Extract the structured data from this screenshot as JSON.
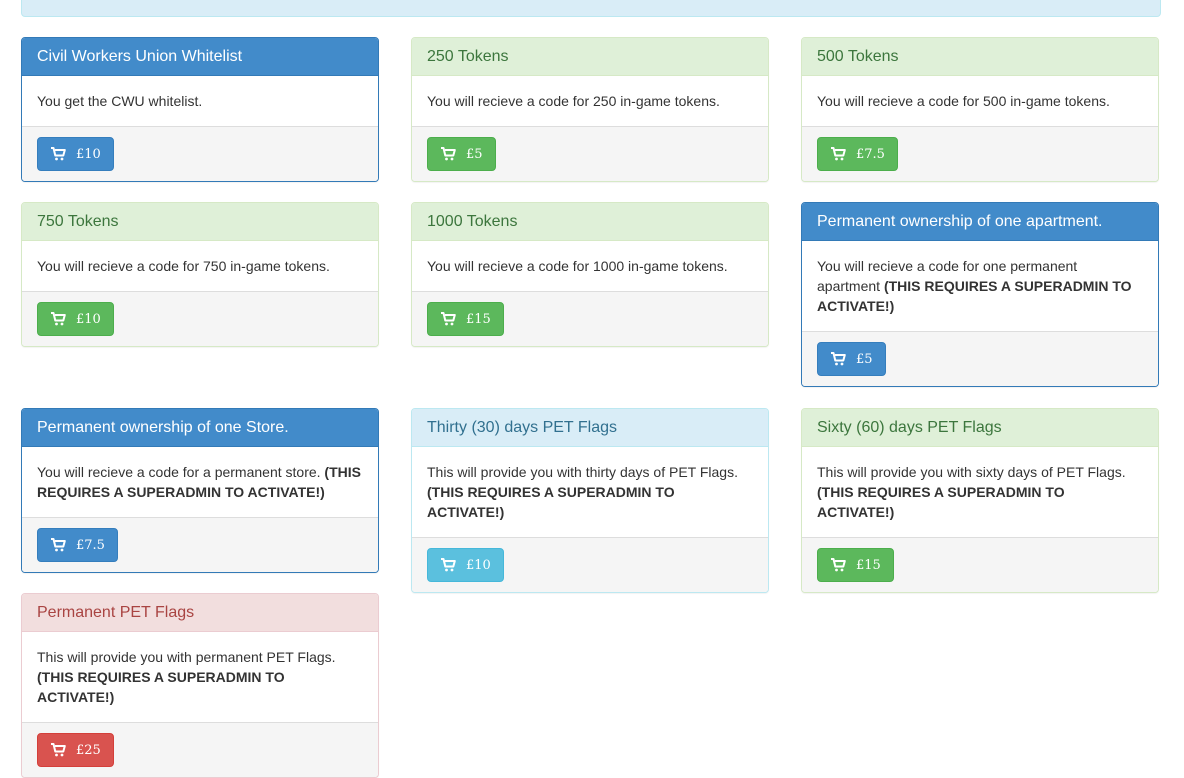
{
  "colors": {
    "primary": "#428bca",
    "success": "#5cb85c",
    "info": "#5bc0de",
    "danger": "#d9534f"
  },
  "products": [
    {
      "title": "Civil Workers Union Whitelist",
      "desc": "You get the CWU whitelist.",
      "note": "",
      "price": "£10"
    },
    {
      "title": "250 Tokens",
      "desc": "You will recieve a code for 250 in-game tokens.",
      "note": "",
      "price": "£5"
    },
    {
      "title": "500 Tokens",
      "desc": "You will recieve a code for 500 in-game tokens.",
      "note": "",
      "price": "£7.5"
    },
    {
      "title": "750 Tokens",
      "desc": "You will recieve a code for 750 in-game tokens.",
      "note": "",
      "price": "£10"
    },
    {
      "title": "1000 Tokens",
      "desc": "You will recieve a code for 1000 in-game tokens.",
      "note": "",
      "price": "£15"
    },
    {
      "title": "Permanent ownership of one apartment.",
      "desc": "You will recieve a code for one permanent apartment ",
      "note": "(THIS REQUIRES A SUPERADMIN TO ACTIVATE!)",
      "price": "£5"
    },
    {
      "title": "Permanent ownership of one Store.",
      "desc": "You will recieve a code for a permanent store. ",
      "note": "(THIS REQUIRES A SUPERADMIN TO ACTIVATE!)",
      "price": "£7.5"
    },
    {
      "title": "Thirty (30) days PET Flags",
      "desc": "This will provide you with thirty days of PET Flags. ",
      "note": "(THIS REQUIRES A SUPERADMIN TO ACTIVATE!)",
      "price": "£10"
    },
    {
      "title": "Sixty (60) days PET Flags",
      "desc": "This will provide you with sixty days of PET Flags. ",
      "note": "(THIS REQUIRES A SUPERADMIN TO ACTIVATE!)",
      "price": "£15"
    },
    {
      "title": "Permanent PET Flags",
      "desc": "This will provide you with permanent PET Flags. ",
      "note": "(THIS REQUIRES A SUPERADMIN TO ACTIVATE!)",
      "price": "£25"
    }
  ]
}
